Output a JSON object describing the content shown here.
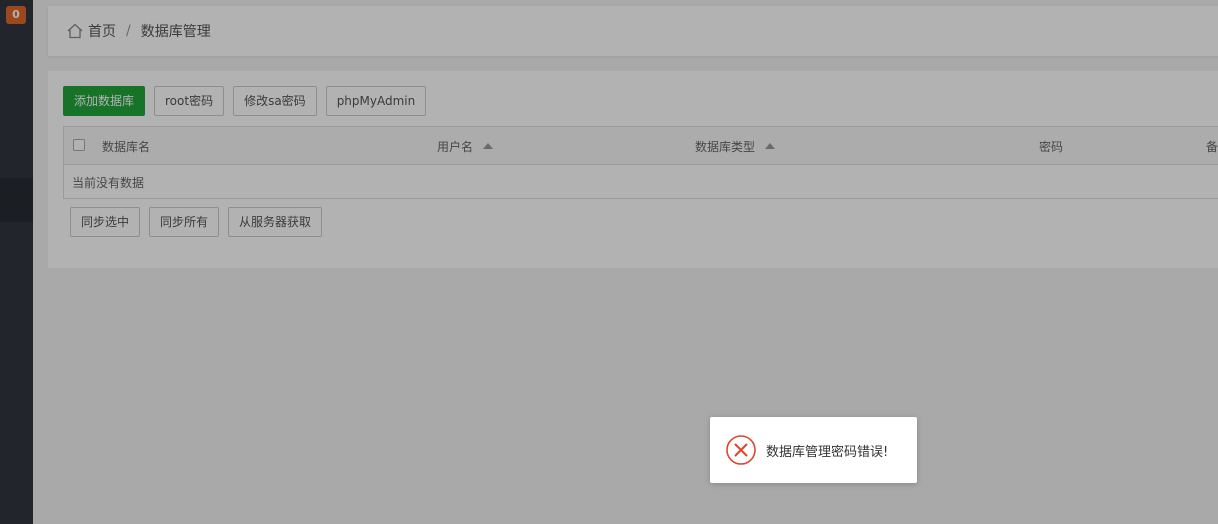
{
  "sidebar": {
    "badge_count": "0"
  },
  "breadcrumb": {
    "home_label": "首页",
    "separator": "/",
    "current": "数据库管理"
  },
  "toolbar": {
    "add_db": "添加数据库",
    "root_pwd": "root密码",
    "sa_pwd": "修改sa密码",
    "phpmyadmin": "phpMyAdmin"
  },
  "table": {
    "columns": [
      "数据库名",
      "用户名",
      "数据库类型",
      "密码",
      "备"
    ],
    "empty_text": "当前没有数据"
  },
  "bottom_actions": {
    "sync_selected": "同步选中",
    "sync_all": "同步所有",
    "fetch_from_server": "从服务器获取"
  },
  "toast": {
    "message": "数据库管理密码错误!",
    "icon": "error-circle-icon",
    "color": "#e0452d"
  },
  "colors": {
    "primary": "#20a53a",
    "sidebar": "#313640",
    "badge": "#e0682b"
  }
}
